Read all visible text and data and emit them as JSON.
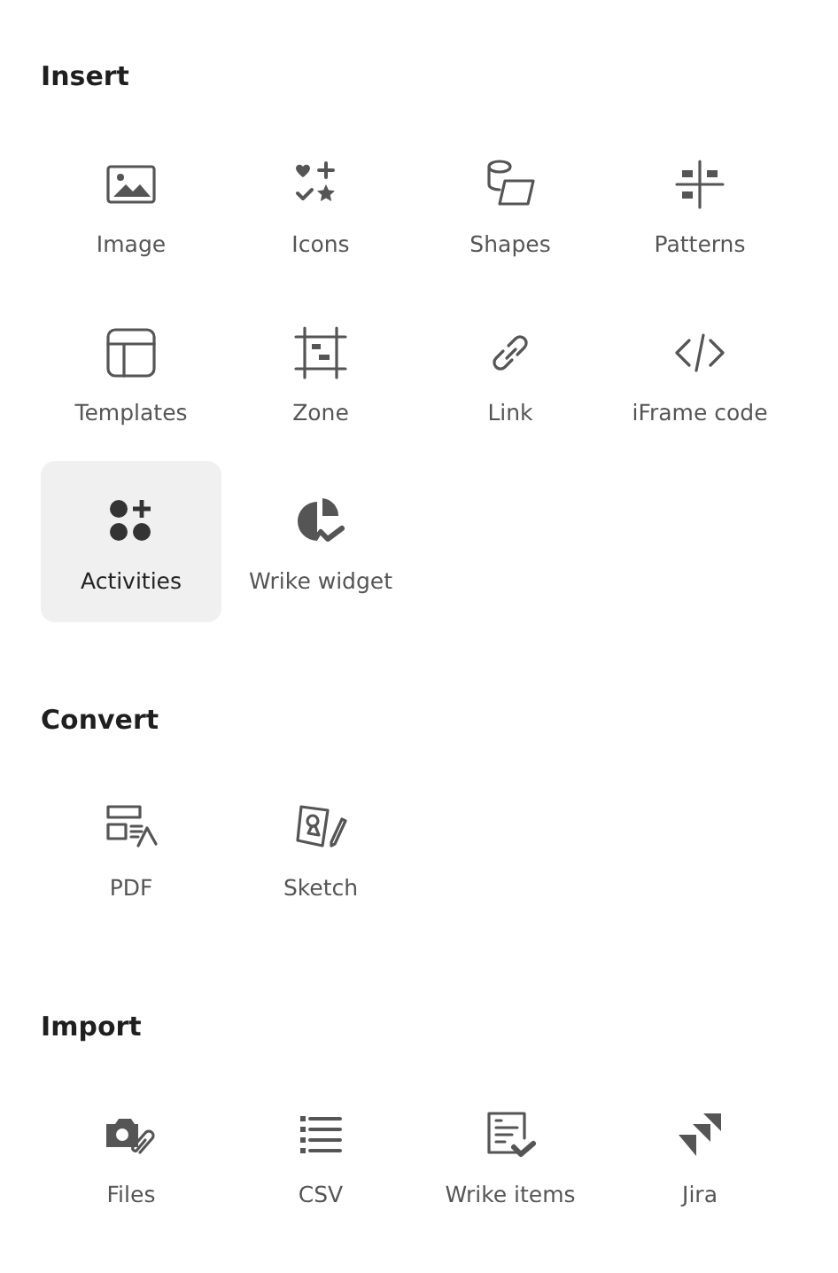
{
  "sections": [
    {
      "title": "Insert",
      "items": [
        {
          "label": "Image",
          "selected": false
        },
        {
          "label": "Icons",
          "selected": false
        },
        {
          "label": "Shapes",
          "selected": false
        },
        {
          "label": "Patterns",
          "selected": false
        },
        {
          "label": "Templates",
          "selected": false
        },
        {
          "label": "Zone",
          "selected": false
        },
        {
          "label": "Link",
          "selected": false
        },
        {
          "label": "iFrame code",
          "selected": false
        },
        {
          "label": "Activities",
          "selected": true
        },
        {
          "label": "Wrike widget",
          "selected": false
        }
      ]
    },
    {
      "title": "Convert",
      "items": [
        {
          "label": "PDF",
          "selected": false
        },
        {
          "label": "Sketch",
          "selected": false
        }
      ]
    },
    {
      "title": "Import",
      "items": [
        {
          "label": "Files",
          "selected": false
        },
        {
          "label": "CSV",
          "selected": false
        },
        {
          "label": "Wrike items",
          "selected": false
        },
        {
          "label": "Jira",
          "selected": false
        }
      ]
    }
  ]
}
